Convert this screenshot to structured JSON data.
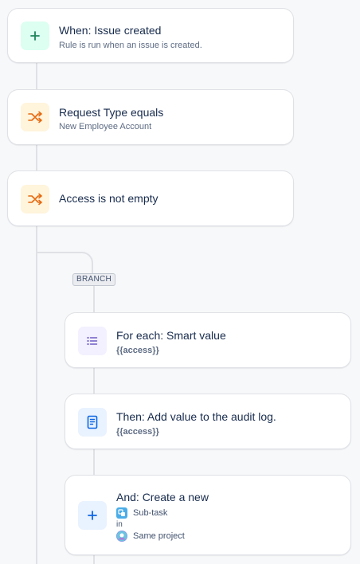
{
  "trigger": {
    "title": "When: Issue created",
    "subtitle": "Rule is run when an issue is created.",
    "icon": "plus-icon"
  },
  "condition1": {
    "title": "Request Type equals",
    "subtitle": "New Employee Account",
    "icon": "shuffle-icon"
  },
  "condition2": {
    "title": "Access is not empty",
    "icon": "shuffle-icon"
  },
  "branch": {
    "label": "BRANCH"
  },
  "for_each": {
    "title": "For each: Smart value",
    "value": "{{access}}",
    "icon": "list-icon"
  },
  "audit": {
    "title": "Then: Add value to the audit log.",
    "value": "{{access}}",
    "icon": "document-icon"
  },
  "create": {
    "title": "And: Create a new",
    "issue_type": "Sub-task",
    "connector": "in",
    "project": "Same project",
    "icon": "plus-icon"
  },
  "colors": {
    "trigger_bg": "#dcfff1",
    "trigger_fg": "#1f845a",
    "condition_bg": "#fff4dc",
    "condition_fg": "#e56910",
    "branch_bg": "#f3f0ff",
    "branch_fg": "#6e5dc6",
    "action_bg": "#e9f2ff",
    "action_fg": "#0c66e4"
  }
}
